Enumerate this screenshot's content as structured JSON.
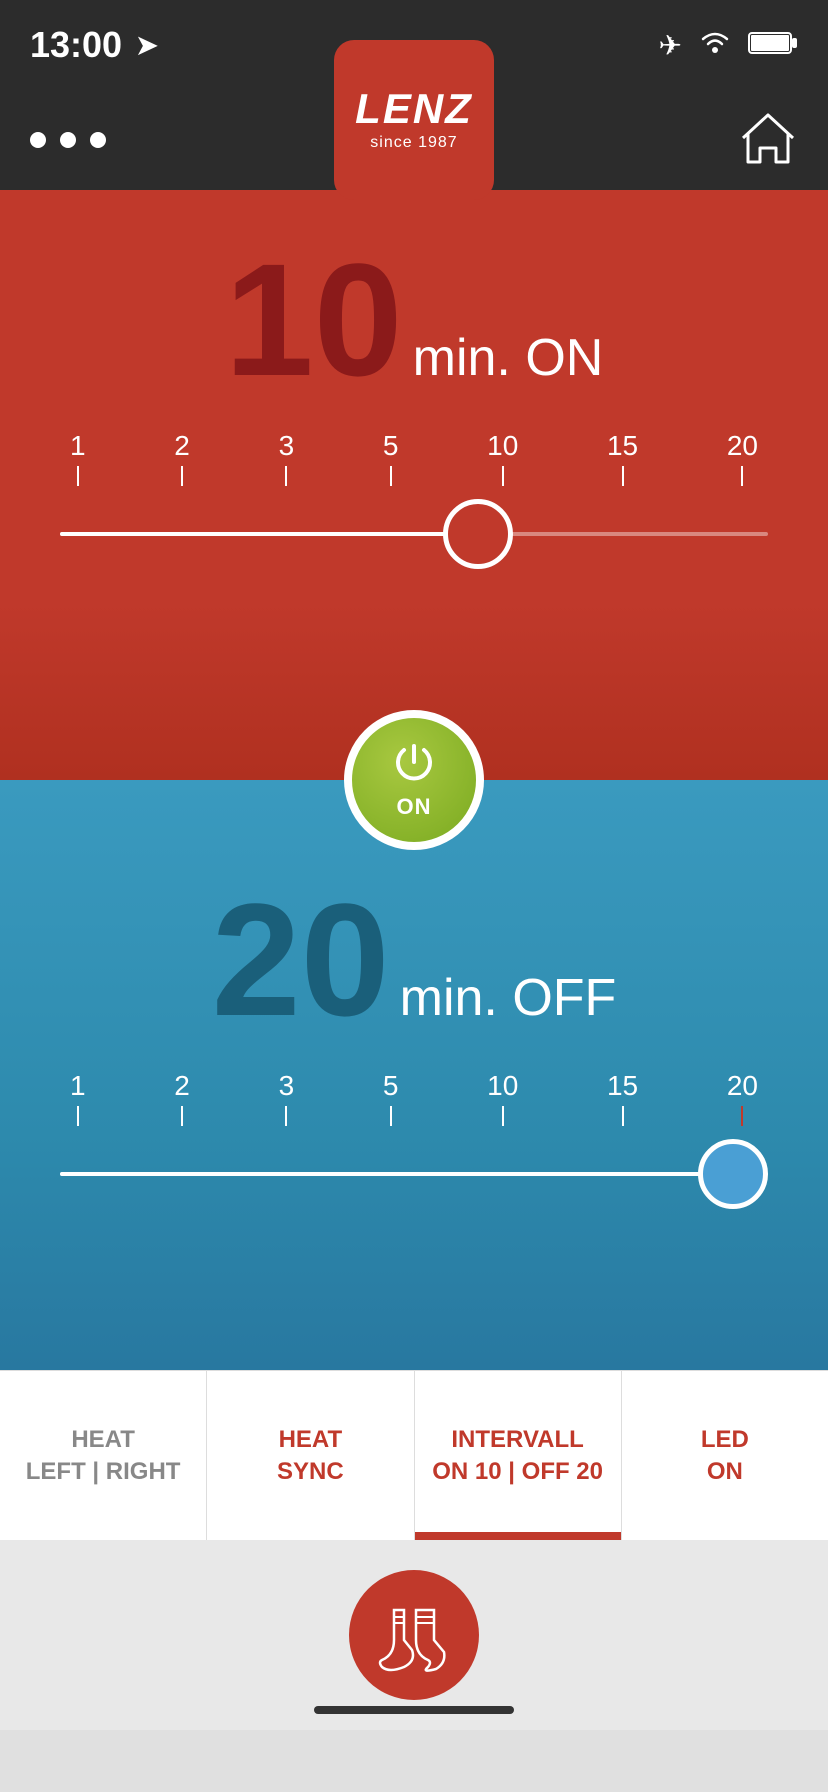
{
  "statusBar": {
    "time": "13:00",
    "icons": [
      "airplane",
      "wifi",
      "battery"
    ]
  },
  "header": {
    "logo": "LENZ",
    "logoSubtitle": "since 1987",
    "homeIcon": "⌂"
  },
  "sectionOn": {
    "timerNumber": "10",
    "timerLabel": "min. ON",
    "sliderMarks": [
      "1",
      "2",
      "3",
      "5",
      "10",
      "15",
      "20"
    ],
    "sliderValue": 10,
    "sliderPercent": 59
  },
  "powerButton": {
    "label": "ON"
  },
  "sectionOff": {
    "timerNumber": "20",
    "timerLabel": "min. OFF",
    "sliderMarks": [
      "1",
      "2",
      "3",
      "5",
      "10",
      "15",
      "20"
    ],
    "sliderValue": 20,
    "sliderPercent": 95
  },
  "tabs": [
    {
      "id": "heat-left-right",
      "line1": "HEAT",
      "line2": "LEFT | RIGHT",
      "colorClass": "gray",
      "active": false
    },
    {
      "id": "heat-sync",
      "line1": "HEAT",
      "line2": "SYNC",
      "colorClass": "red",
      "active": false
    },
    {
      "id": "intervall",
      "line1": "INTERVALL",
      "line2": "ON 10 | OFF 20",
      "colorClass": "red",
      "active": true
    },
    {
      "id": "led-on",
      "line1": "LED",
      "line2": "ON",
      "colorClass": "red",
      "active": false
    }
  ],
  "bottomNav": {
    "homeIndicator": true
  }
}
